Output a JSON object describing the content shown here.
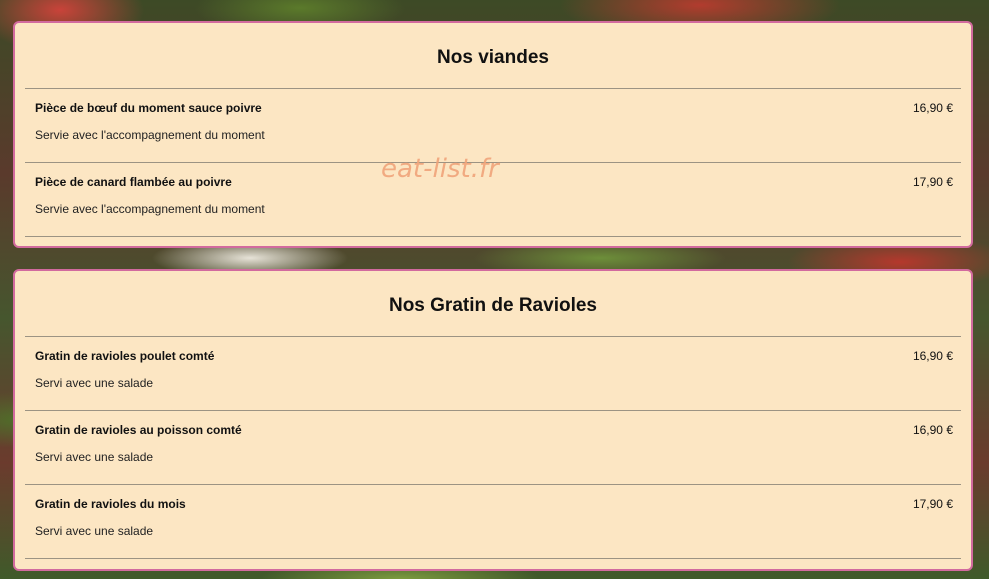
{
  "watermark": "eat-list.fr",
  "sections": [
    {
      "title": "Nos viandes",
      "items": [
        {
          "name": "Pièce de bœuf du moment sauce poivre",
          "price": "16,90 €",
          "description": "Servie avec l'accompagnement du moment"
        },
        {
          "name": "Pièce de canard flambée au poivre",
          "price": "17,90 €",
          "description": "Servie avec l'accompagnement du moment"
        }
      ]
    },
    {
      "title": "Nos Gratin de Ravioles",
      "items": [
        {
          "name": "Gratin de ravioles poulet comté",
          "price": "16,90 €",
          "description": "Servi avec une salade"
        },
        {
          "name": "Gratin de ravioles au poisson comté",
          "price": "16,90 €",
          "description": "Servi avec une salade"
        },
        {
          "name": "Gratin de ravioles du mois",
          "price": "17,90 €",
          "description": "Servi avec une salade"
        }
      ]
    }
  ],
  "colors": {
    "panel_background": "#fce6c3",
    "panel_border": "#d26a9e",
    "watermark": "#f0a47a"
  }
}
